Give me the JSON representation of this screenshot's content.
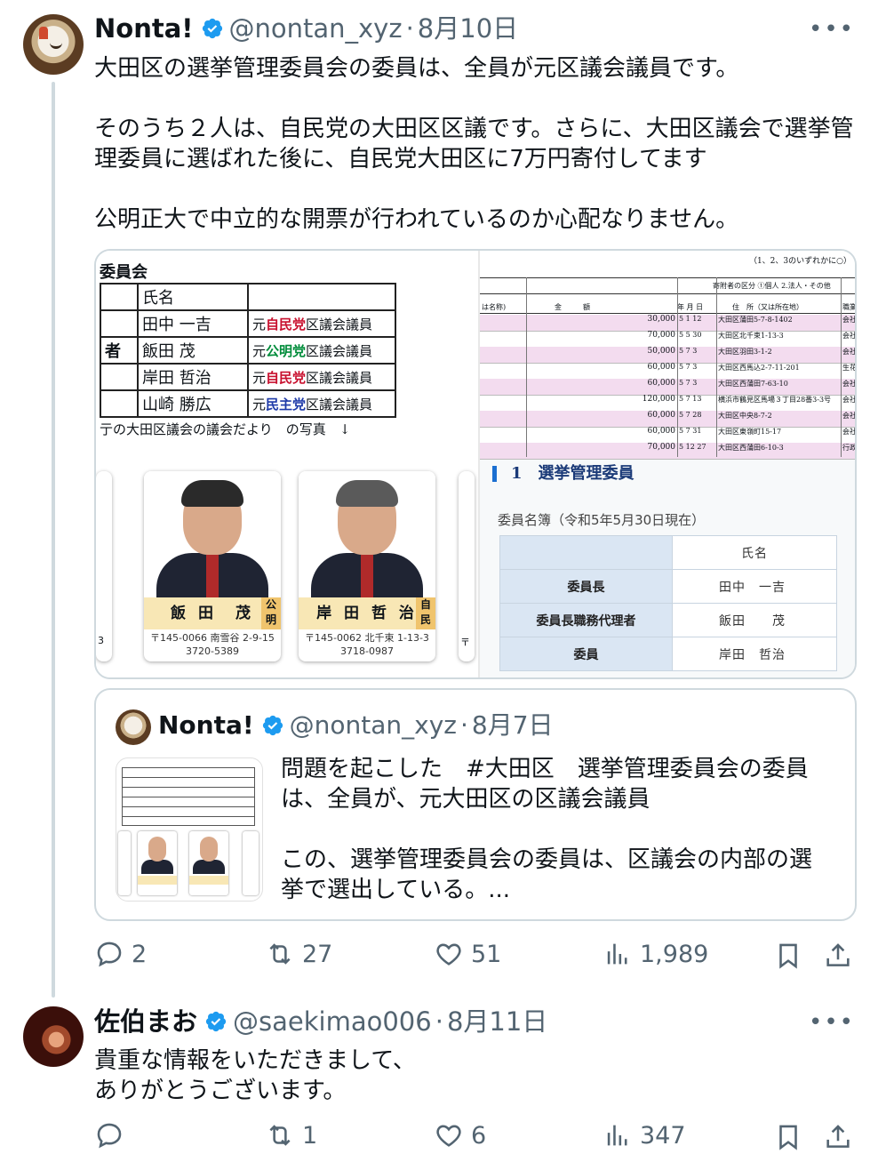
{
  "tweet1": {
    "name": "Nonta!",
    "handle": "@nontan_xyz",
    "sep": "·",
    "date": "8月10日",
    "more": "•••",
    "text": "大田区の選挙管理委員会の委員は、全員が元区議会議員です。\n\nそのうち２人は、自民党の大田区区議です。さらに、大田区議会で選挙管理委員に選ばれた後に、自民党大田区に7万円寄付してます\n\n公明正大で中立的な開票が行われているのか心配なりません。",
    "media": {
      "doc_title": "委員会",
      "table_header": "氏名",
      "side_label": "者",
      "rows": [
        {
          "name": "田中 一吉",
          "prefix": "元",
          "party": "自民党",
          "suffix": "区議会議員",
          "party_color": "red"
        },
        {
          "name": "飯田 茂",
          "prefix": "元",
          "party": "公明党",
          "suffix": "区議会議員",
          "party_color": "green"
        },
        {
          "name": "岸田 哲治",
          "prefix": "元",
          "party": "自民党",
          "suffix": "区議会議員",
          "party_color": "red"
        },
        {
          "name": "山崎 勝広",
          "prefix": "元",
          "party": "民主党",
          "suffix": "区議会議員",
          "party_color": "blue"
        }
      ],
      "note": "亍の大田区議会の議会だより　の写真　↓",
      "cards": [
        {
          "name": "飯 田　茂",
          "tag": "公明",
          "addr1": "〒145-0066 南雪谷 2-9-15",
          "addr2": "3720-5389"
        },
        {
          "name": "岸 田 哲 治",
          "tag": "自民",
          "addr1": "〒145-0062 北千束 1-13-3",
          "addr2": "3718-0987"
        }
      ],
      "card_edge_left_label": "3",
      "card_edge_right_label": "〒",
      "ledger": {
        "top_note": "（1、2、3のいずれかに○）",
        "header_left": "は名称)",
        "header_amount": "金　　　額",
        "header_date": "年 月 日",
        "header_address": "住　所（又は所在地）",
        "header_kind": "職業",
        "header_donor": "寄附者の区分 ①個人 2.法人・その他",
        "rows": [
          {
            "amount": "30,000",
            "date": "5 1 12",
            "address": "大田区蒲田5-7-8-1402",
            "kind": "会社"
          },
          {
            "amount": "70,000",
            "date": "5 5 30",
            "address": "大田区北千束1-13-3",
            "kind": "会社"
          },
          {
            "amount": "50,000",
            "date": "5 7 3",
            "address": "大田区羽田3-1-2",
            "kind": "会社"
          },
          {
            "amount": "60,000",
            "date": "5 7 3",
            "address": "大田区西馬込2-7-11-201",
            "kind": "生花"
          },
          {
            "amount": "60,000",
            "date": "5 7 3",
            "address": "大田区西蒲田7-63-10",
            "kind": "会社"
          },
          {
            "amount": "120,000",
            "date": "5 7 13",
            "address": "横浜市鶴見区馬場３丁目28番3-3号",
            "kind": "会社"
          },
          {
            "amount": "60,000",
            "date": "5 7 28",
            "address": "大田区中央8-7-2",
            "kind": "会社"
          },
          {
            "amount": "60,000",
            "date": "5 7 31",
            "address": "大田区東嶺町15-17",
            "kind": "会社"
          },
          {
            "amount": "70,000",
            "date": "5 12 27",
            "address": "大田区西蒲田6-10-3",
            "kind": "行政"
          }
        ]
      },
      "member_heading": "1　選挙管理委員",
      "roster_title": "委員名簿（令和5年5月30日現在）",
      "roster_header": "氏名",
      "roster": [
        {
          "role": "委員長",
          "name": "田中　一吉"
        },
        {
          "role": "委員長職務代理者",
          "name": "飯田　　茂"
        },
        {
          "role": "委員",
          "name": "岸田　哲治"
        }
      ]
    },
    "quote": {
      "name": "Nonta!",
      "handle": "@nontan_xyz",
      "sep": "·",
      "date": "8月7日",
      "text": "問題を起こした　#大田区　選挙管理委員会の委員は、全員が、元大田区の区議会議員\n\nこの、選挙管理委員会の委員は、区議会の内部の選挙で選出している。..."
    },
    "actions": {
      "replies": "2",
      "reposts": "27",
      "likes": "51",
      "views": "1,989"
    }
  },
  "tweet2": {
    "name": "佐伯まお",
    "handle": "@saekimao006",
    "sep": "·",
    "date": "8月11日",
    "more": "•••",
    "text": "貴重な情報をいただきまして、\nありがとうございます。",
    "actions": {
      "replies": "",
      "reposts": "1",
      "likes": "6",
      "views": "347"
    }
  },
  "colors": {
    "verified": "#1d9bf0",
    "muted": "#536471",
    "border": "#cfd9de"
  }
}
